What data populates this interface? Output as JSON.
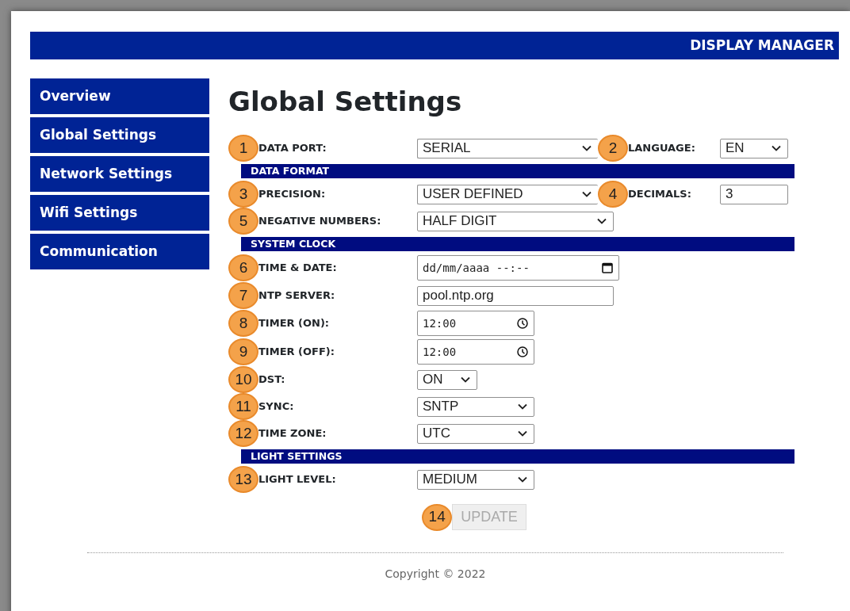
{
  "header": {
    "title": "DISPLAY MANAGER"
  },
  "sidebar": {
    "items": [
      {
        "label": "Overview",
        "selected": false
      },
      {
        "label": "Global Settings",
        "selected": false
      },
      {
        "label": "Network Settings",
        "selected": false
      },
      {
        "label": "Wifi Settings",
        "selected": false
      },
      {
        "label": "Communication",
        "selected": false
      }
    ]
  },
  "page_title": "Global Settings",
  "form": {
    "rows": [
      {
        "kind": "field",
        "items": [
          {
            "callout": "1",
            "label": "DATA PORT:",
            "kind": "select",
            "value": "SERIAL"
          },
          {
            "callout": "2",
            "label": "LANGUAGE:",
            "kind": "select",
            "value": "EN"
          }
        ]
      },
      {
        "kind": "section",
        "title": "DATA FORMAT"
      },
      {
        "kind": "field",
        "items": [
          {
            "callout": "3",
            "label": "PRECISION:",
            "kind": "select",
            "value": "USER DEFINED"
          },
          {
            "callout": "4",
            "label": "DECIMALS:",
            "kind": "text",
            "value": "3"
          }
        ]
      },
      {
        "kind": "field",
        "items": [
          {
            "callout": "5",
            "label": "NEGATIVE NUMBERS:",
            "kind": "select",
            "value": "HALF DIGIT"
          }
        ]
      },
      {
        "kind": "section",
        "title": "SYSTEM CLOCK"
      },
      {
        "kind": "field",
        "items": [
          {
            "callout": "6",
            "label": "TIME & DATE:",
            "kind": "datetime",
            "placeholder": "dd/mm/aaaa --:--"
          }
        ]
      },
      {
        "kind": "field",
        "items": [
          {
            "callout": "7",
            "label": "NTP SERVER:",
            "kind": "text",
            "value": "pool.ntp.org"
          }
        ]
      },
      {
        "kind": "field",
        "items": [
          {
            "callout": "8",
            "label": "TIMER (ON):",
            "kind": "time",
            "value": "12:00"
          }
        ]
      },
      {
        "kind": "field",
        "items": [
          {
            "callout": "9",
            "label": "TIMER (OFF):",
            "kind": "time",
            "value": "12:00"
          }
        ]
      },
      {
        "kind": "field",
        "items": [
          {
            "callout": "10",
            "label": "DST:",
            "kind": "select",
            "value": "ON"
          }
        ]
      },
      {
        "kind": "field",
        "items": [
          {
            "callout": "11",
            "label": "SYNC:",
            "kind": "select",
            "value": "SNTP"
          }
        ]
      },
      {
        "kind": "field",
        "items": [
          {
            "callout": "12",
            "label": "TIME ZONE:",
            "kind": "select",
            "value": "UTC"
          }
        ]
      },
      {
        "kind": "section",
        "title": "LIGHT SETTINGS"
      },
      {
        "kind": "field",
        "items": [
          {
            "callout": "13",
            "label": "LIGHT LEVEL:",
            "kind": "select",
            "value": "MEDIUM"
          }
        ]
      }
    ]
  },
  "update_button": {
    "callout": "14",
    "label": "UPDATE",
    "disabled": true
  },
  "footer": {
    "text": "Copyright © 2022"
  }
}
